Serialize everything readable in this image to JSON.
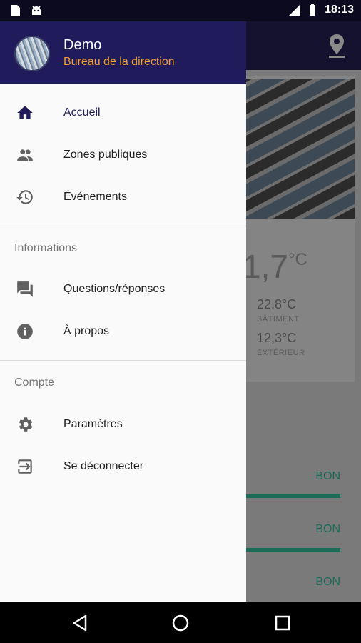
{
  "status_bar": {
    "time": "18:13",
    "left_icons": [
      "sd-card-icon",
      "android-icon"
    ],
    "right_icons": [
      "lte-signal-icon",
      "battery-icon"
    ]
  },
  "background_app": {
    "toolbar_icon": "location-pin-icon",
    "temperature_main": "1,7",
    "temperature_unit": "°C",
    "building_temp": "22,8°C",
    "building_label": "BÂTIMENT",
    "outside_temp": "12,3°C",
    "outside_label": "EXTÉRIEUR",
    "status_labels": [
      "BON",
      "BON",
      "BON"
    ],
    "accent_color": "#1b6b58"
  },
  "drawer": {
    "header": {
      "user_name": "Demo",
      "user_role": "Bureau de la direction",
      "header_color": "#201c5c",
      "role_color": "#f29a2e"
    },
    "main_items": [
      {
        "label": "Accueil",
        "icon": "home-icon",
        "active": true
      },
      {
        "label": "Zones publiques",
        "icon": "people-icon",
        "active": false
      },
      {
        "label": "Événements",
        "icon": "history-icon",
        "active": false
      }
    ],
    "sections": [
      {
        "title": "Informations",
        "items": [
          {
            "label": "Questions/réponses",
            "icon": "forum-icon"
          },
          {
            "label": "À propos",
            "icon": "info-icon"
          }
        ]
      },
      {
        "title": "Compte",
        "items": [
          {
            "label": "Paramètres",
            "icon": "gear-icon"
          },
          {
            "label": "Se déconnecter",
            "icon": "logout-icon"
          }
        ]
      }
    ]
  },
  "nav_bar": {
    "buttons": [
      "back-icon",
      "home-circle-icon",
      "recents-icon"
    ]
  }
}
